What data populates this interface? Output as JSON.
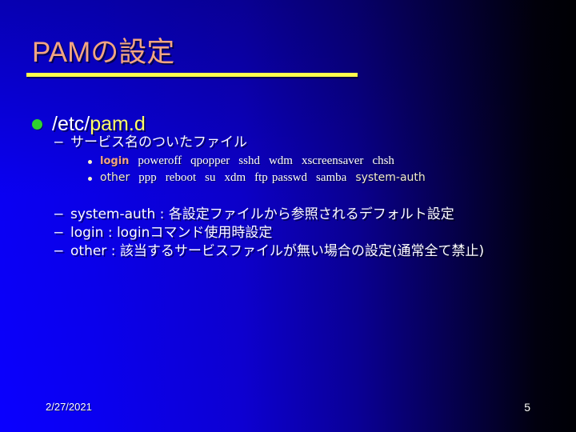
{
  "slide": {
    "title": "PAMの設定",
    "page_number": "5",
    "date": "2/27/2021",
    "colors": {
      "title": "#f2a582",
      "rule": "#ffff4d",
      "bullet_level1": "#2fd42f",
      "bullet_level3": "#f7f0c8",
      "highlight_yellow": "#ffff66",
      "highlight_peach": "#f2a582",
      "highlight_cream": "#f0ead2",
      "background_left": "#0a00ff",
      "background_right": "#000005",
      "text": "#ffffff"
    },
    "body": {
      "level1": {
        "text_plain": "/etc/",
        "text_highlight": "pam.d"
      },
      "level2_files_label": "サービス名のついたファイル",
      "level3_rows": [
        {
          "tokens": [
            {
              "text": "login",
              "style": "peach"
            },
            {
              "text": "poweroff",
              "style": "serif"
            },
            {
              "text": "qpopper",
              "style": "serif"
            },
            {
              "text": "sshd",
              "style": "serif"
            },
            {
              "text": "wdm",
              "style": "serif"
            },
            {
              "text": "xscreensaver",
              "style": "serif"
            },
            {
              "text": "chsh",
              "style": "serif"
            }
          ]
        },
        {
          "tokens": [
            {
              "text": "other",
              "style": "cream"
            },
            {
              "text": "ppp",
              "style": "serif"
            },
            {
              "text": "reboot",
              "style": "serif"
            },
            {
              "text": "su",
              "style": "serif"
            },
            {
              "text": "xdm",
              "style": "serif"
            },
            {
              "text": "ftp",
              "style": "serif-tight"
            },
            {
              "text": "passwd",
              "style": "serif"
            },
            {
              "text": "samba",
              "style": "serif"
            },
            {
              "text": "system-auth",
              "style": "cream"
            }
          ]
        }
      ],
      "level2_notes": [
        "system-auth : 各設定ファイルから参照されるデフォルト設定",
        "login : loginコマンド使用時設定",
        "other : 該当するサービスファイルが無い場合の設定(通常全て禁止)"
      ]
    }
  }
}
